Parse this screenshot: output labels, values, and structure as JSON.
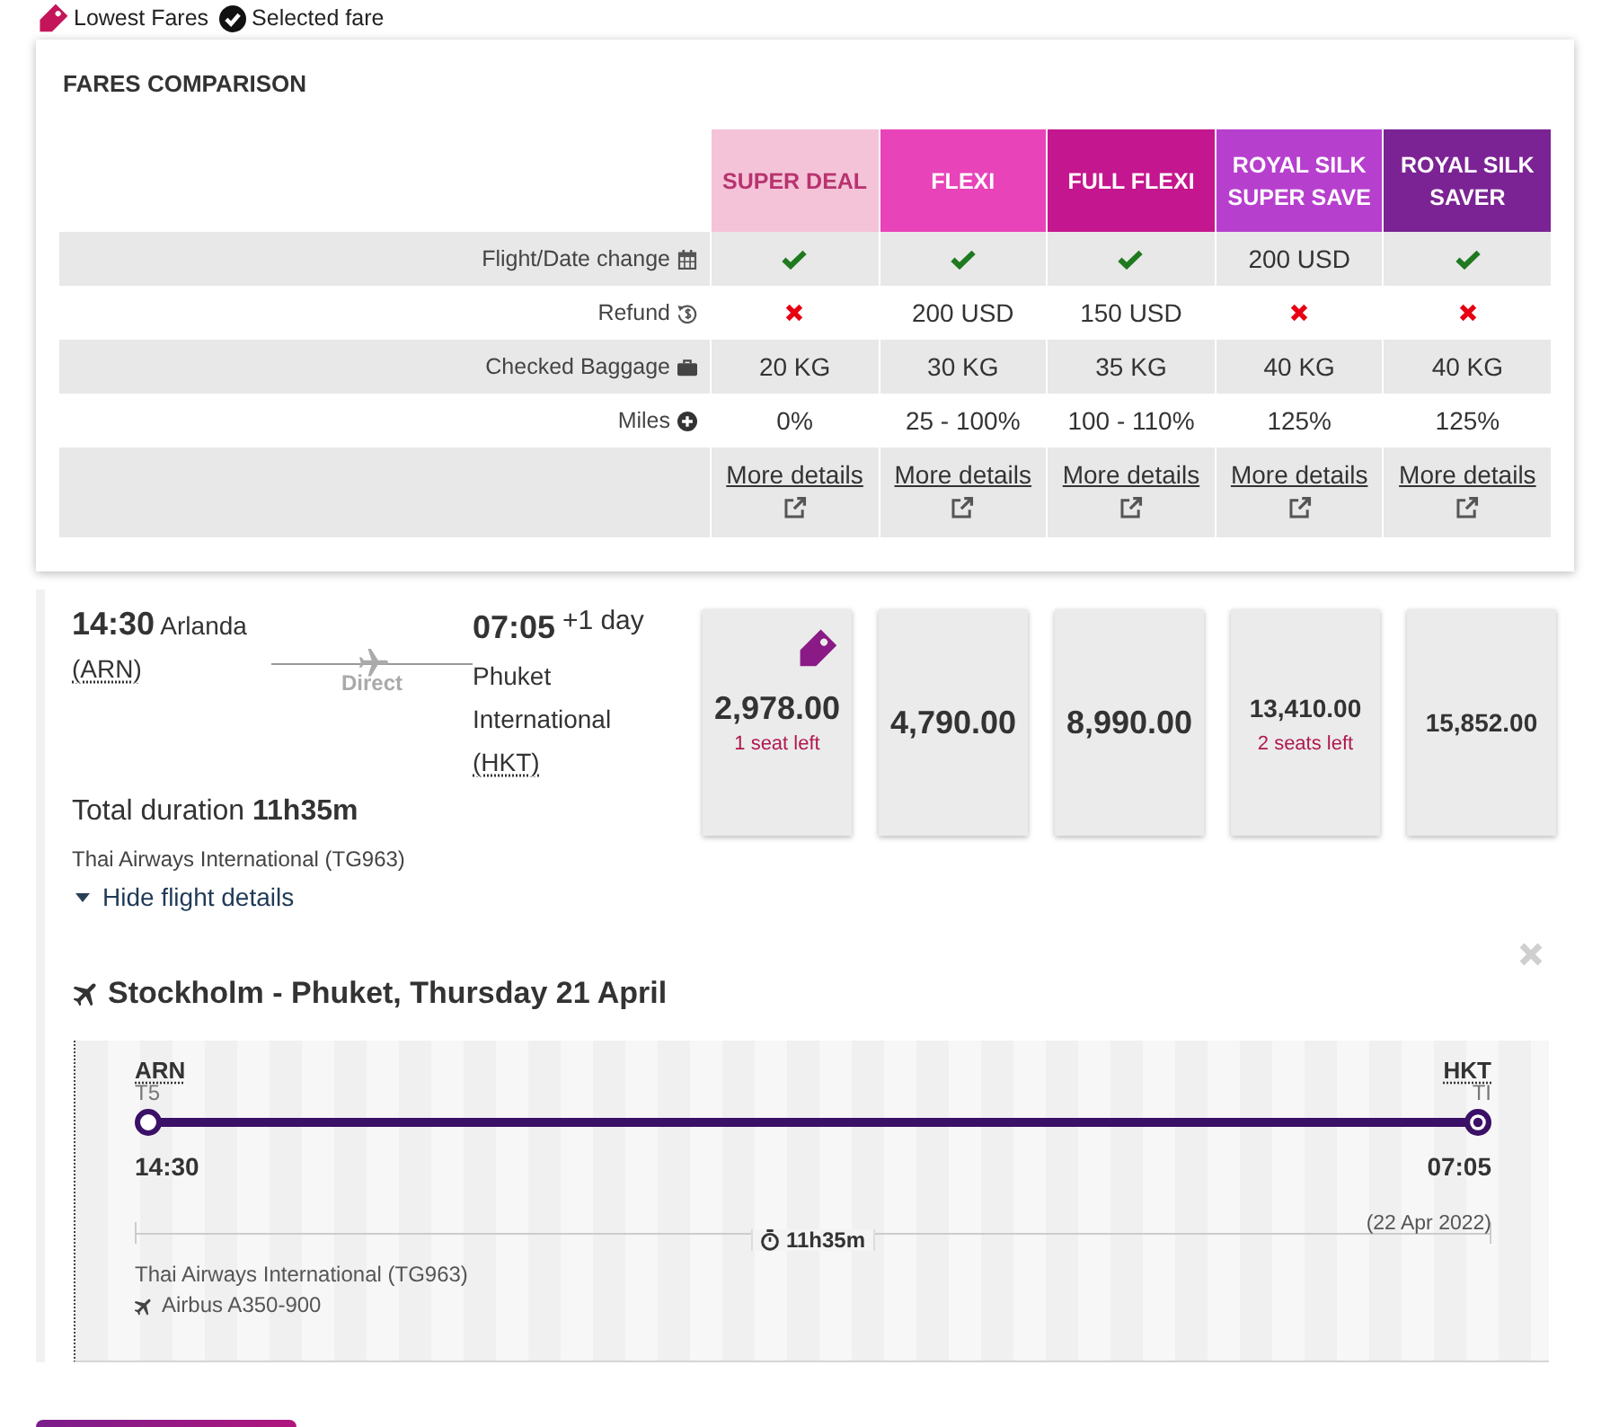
{
  "legend": [
    {
      "kind": "lowest",
      "label": "Lowest Fares"
    },
    {
      "kind": "selected",
      "label": "Selected fare"
    }
  ],
  "fares_comparison": {
    "title": "FARES COMPARISON",
    "fares": [
      {
        "name": "SUPER DEAL",
        "color": "#f4c3d8"
      },
      {
        "name": "FLEXI",
        "color": "#e843b8"
      },
      {
        "name": "FULL FLEXI",
        "color": "#c4168e"
      },
      {
        "name": "ROYAL SILK SUPER SAVE",
        "color": "#b73fce"
      },
      {
        "name": "ROYAL SILK SAVER",
        "color": "#7b2394"
      }
    ],
    "rows": [
      {
        "label": "Flight/Date change",
        "cells": [
          {
            "kind": "check"
          },
          {
            "kind": "check"
          },
          {
            "kind": "check"
          },
          {
            "kind": "text",
            "text": "200 USD"
          },
          {
            "kind": "check"
          }
        ]
      },
      {
        "label": "Refund",
        "cells": [
          {
            "kind": "cross"
          },
          {
            "kind": "text",
            "text": "200 USD"
          },
          {
            "kind": "text",
            "text": "150 USD"
          },
          {
            "kind": "cross"
          },
          {
            "kind": "cross"
          }
        ]
      },
      {
        "label": "Checked Baggage",
        "cells": [
          {
            "kind": "text",
            "text": "20 KG"
          },
          {
            "kind": "text",
            "text": "30 KG"
          },
          {
            "kind": "text",
            "text": "35 KG"
          },
          {
            "kind": "text",
            "text": "40 KG"
          },
          {
            "kind": "text",
            "text": "40 KG"
          }
        ]
      },
      {
        "label": "Miles",
        "cells": [
          {
            "kind": "text",
            "text": "0%"
          },
          {
            "kind": "text",
            "text": "25 - 100%"
          },
          {
            "kind": "text",
            "text": "100 - 110%"
          },
          {
            "kind": "text",
            "text": "125%"
          },
          {
            "kind": "text",
            "text": "125%"
          }
        ]
      }
    ],
    "links": [
      "More details",
      "More details",
      "More details",
      "More details",
      "More details"
    ]
  },
  "flight": {
    "departure": {
      "time": "14:30",
      "airport": "Arlanda",
      "code": "(ARN)"
    },
    "stops": "Direct",
    "arrival": {
      "time": "07:05",
      "day_offset": "+1 day",
      "airport": "Phuket International",
      "code": "(HKT)"
    },
    "total_duration": "Total duration **11h35m**",
    "airline": "Thai Airways International (TG963)",
    "toggle": {
      "label": "Hide flight details",
      "expanded": true
    },
    "prices": [
      {
        "amount": "2,978.00",
        "note": "1 seat left",
        "lowest": true
      },
      {
        "amount": "4,790.00",
        "lowest": false
      },
      {
        "amount": "8,990.00",
        "lowest": false
      },
      {
        "amount": "13,410.00",
        "note": "2 seats left",
        "lowest": false
      },
      {
        "amount": "15,852.00",
        "lowest": false
      }
    ]
  },
  "details": {
    "title": "Stockholm - Phuket, Thursday 21 April",
    "origin": {
      "code": "ARN",
      "terminal": "T5",
      "time": "14:30"
    },
    "destination": {
      "code": "HKT",
      "terminal": "TI",
      "time": "07:05",
      "date": "(22 Apr 2022)"
    },
    "duration": "11h35m",
    "airline": "Thai Airways International (TG963)",
    "aircraft": "Airbus A350-900"
  }
}
